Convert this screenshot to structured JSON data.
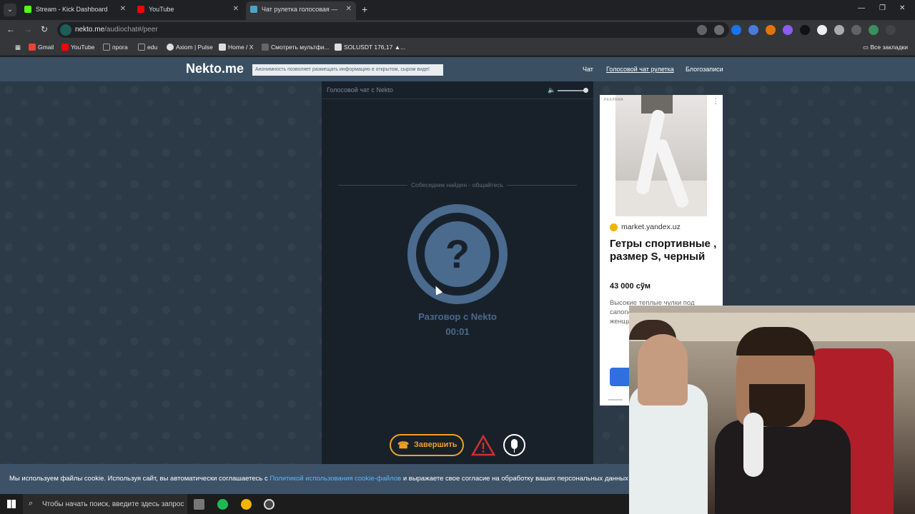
{
  "tabs": [
    {
      "label": "Stream - Kick Dashboard",
      "favicon_color": "#53fc18"
    },
    {
      "label": "YouTube",
      "favicon_color": "#ff0000"
    },
    {
      "label": "Чат рулетка голосовая — ",
      "favicon_color": "#4aa3c8"
    }
  ],
  "address": {
    "host": "nekto.me",
    "path": "/audiochat#/peer"
  },
  "bookmarks": [
    {
      "label": "Gmail",
      "color": "#ea4335"
    },
    {
      "label": "YouTube",
      "color": "#ff0000"
    },
    {
      "label": "прога",
      "color": "#9aa0a6"
    },
    {
      "label": "edu",
      "color": "#9aa0a6"
    },
    {
      "label": "Axiom | Pulse",
      "color": "#dddddd"
    },
    {
      "label": "Home / X",
      "color": "#dddddd"
    },
    {
      "label": "Смотреть мультфи...",
      "color": "#666666"
    },
    {
      "label": "SOLUSDT 176,17 ▲...",
      "color": "#dddddd"
    }
  ],
  "bookmarks_all": "Все закладки",
  "site": {
    "logo": "Nekto.me",
    "notice": "Анонимность позволяет размещать информацию в открытом, сыром виде!",
    "menu": [
      "Чат",
      "Голосовой чат рулетка",
      "Блогозаписи"
    ]
  },
  "chat": {
    "title": "Голосовой чат с Nekto",
    "status": "Собеседник найден - общайтесь",
    "avatar_symbol": "?",
    "talk_label": "Разговор с Nekto",
    "timer": "00:01",
    "end_button": "Завершить"
  },
  "ad": {
    "tag": "РЕКЛАМА",
    "source": "market.yandex.uz",
    "title": "Гетры спортивные , размер S, черный",
    "price": "43 000 сўм",
    "description": "Высокие теплые чулки под сапоги. Дополнительно для женщин"
  },
  "cookie": {
    "before": "Мы используем файлы cookie. Используя сайт, вы автоматически соглашаетесь с ",
    "link": "Политикой использования cookie-файлов",
    "after": " и выражаете свое согласие на обработку ваших персональных данных с и"
  },
  "taskbar": {
    "search_placeholder": "Чтобы начать поиск, введите здесь запрос"
  },
  "colors": {
    "accent": "#f0a022",
    "avatar": "#4a6a8e",
    "header": "#3b4f63",
    "panel": "#18212a"
  }
}
